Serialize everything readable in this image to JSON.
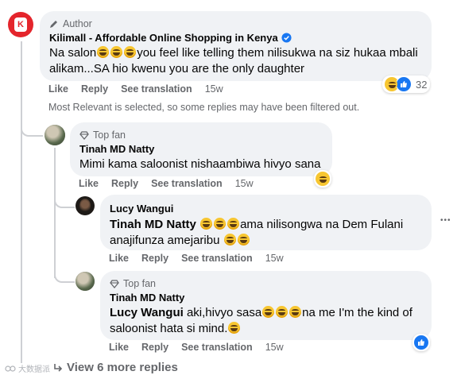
{
  "comments": [
    {
      "badge": "Author",
      "name": "Kilimall - Affordable Online Shopping in Kenya",
      "text_parts": [
        "Na salon",
        "you feel like telling them nilisukwa na siz hukaa mbali alikam...SA hio kwenu you are the only daughter"
      ],
      "actions": {
        "like": "Like",
        "reply": "Reply",
        "translate": "See translation",
        "time": "15w"
      },
      "reaction_count": "32",
      "avatar_letter": "K"
    },
    {
      "badge": "Top fan",
      "name": "Tinah MD Natty",
      "text": "Mimi kama saloonist nishaambiwa hivyo sana",
      "actions": {
        "like": "Like",
        "reply": "Reply",
        "translate": "See translation",
        "time": "15w"
      }
    },
    {
      "name": "Lucy Wangui",
      "mention": "Tinah MD Natty",
      "text_parts": [
        "ama nilisongwa na Dem Fulani anajifunza amejaribu"
      ],
      "actions": {
        "like": "Like",
        "reply": "Reply",
        "translate": "See translation",
        "time": "15w"
      }
    },
    {
      "badge": "Top fan",
      "name": "Tinah MD Natty",
      "mention": "Lucy Wangui",
      "text_parts": [
        " aki,hivyo sasa",
        "na me I'm the kind of saloonist hata si mind."
      ],
      "actions": {
        "like": "Like",
        "reply": "Reply",
        "translate": "See translation",
        "time": "15w"
      }
    }
  ],
  "filter_notice": "Most Relevant is selected, so some replies may have been filtered out.",
  "view_more": "View 6 more replies",
  "watermark": "大数据派",
  "more_menu": "•••",
  "colors": {
    "brand_red": "#e4252c",
    "like_blue": "#1877f2",
    "verified_blue": "#1877f2",
    "emoji_yellow": "#f7c631"
  }
}
